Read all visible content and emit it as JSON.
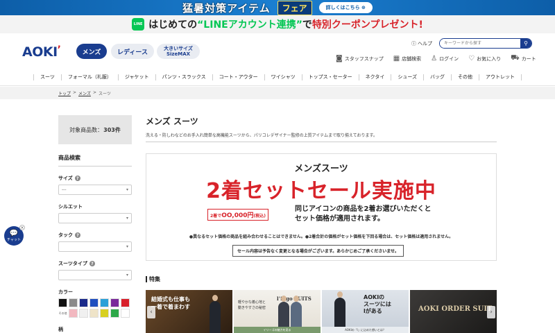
{
  "promo": {
    "title": "猛暑対策アイテム",
    "fair": "フェア",
    "button": "詳しくはこちら ⊕"
  },
  "line_banner": {
    "icon": "LINE",
    "text_pre": "はじめての",
    "text_line": "“LINEアカウント連携”",
    "text_mid": "で",
    "text_red": "特別クーポンプレゼント!"
  },
  "header": {
    "logo": "AOKI",
    "logo_accent": "’",
    "pills": {
      "mens": "メンズ",
      "ladies": "レディース",
      "big_line1": "大きいサイズ",
      "big_line2": "SizeMAX"
    },
    "help": "ヘルプ",
    "search_placeholder": "キーワードから探す",
    "util": {
      "staff": "スタッフスナップ",
      "store": "店舗検索",
      "login": "ログイン",
      "favorite": "お気に入り",
      "cart": "カート"
    }
  },
  "nav": [
    "スーツ",
    "フォーマル（礼服）",
    "ジャケット",
    "パンツ・スラックス",
    "コート・アウター",
    "ワイシャツ",
    "トップス・セーター",
    "ネクタイ",
    "シューズ",
    "バッグ",
    "その他",
    "アウトレット"
  ],
  "breadcrumb": {
    "top": "トップ",
    "mens": "メンズ",
    "current": "スーツ",
    "sep": ">"
  },
  "sidebar": {
    "count_label": "対象商品数：",
    "count_value": "303件",
    "filter_head": "商品検索",
    "size_label": "サイズ",
    "size_value": "---",
    "silhouette_label": "シルエット",
    "tuck_label": "タック",
    "suit_type_label": "スーツタイプ",
    "color_label": "カラー",
    "color_other": "その他",
    "pattern_label": "柄",
    "colors": [
      "#111111",
      "#8a8a8a",
      "#1a2a8a",
      "#1f4fbf",
      "#2aa0d8",
      "#7a2a9a",
      "#d81f2a",
      "#f2b8c0",
      "#f0f0f0",
      "#efe4c8",
      "#d8d020",
      "#2ea84a",
      "#ffffff"
    ]
  },
  "main": {
    "title": "メンズ スーツ",
    "desc": "洗える・防しわなどのお手入れ簡単な高機能スーツから、パリコレデザイナー監修の上質アイテムまで取り揃えております。",
    "sale": {
      "sub": "メンズスーツ",
      "main": "2着セットセール実施中",
      "price_tag_pre": "2着で",
      "price_tag_mid": "OO,000円",
      "price_tag_post": "(税込)",
      "explain1": "同じアイコンの商品を2着お選びいただくと",
      "explain2": "セット価格が適用されます。",
      "note": "●異なるセット価格の商品を組み合わせることはできません。●2着合計の価格がセット価格を下回る場合は、セット価格は適用されません。",
      "notice": "セール内容は予告なく変更となる場合がございます。あらかじめご了承くださいませ。"
    },
    "feature_head": "特集",
    "features": [
      {
        "text1": "結婚式も仕事も",
        "text2": "一着で着まわす"
      },
      {
        "title": "l’illgo SUITS",
        "text1": "軽やかな着心地と",
        "text2": "動きやすさの秘密",
        "foot": "イリーゴの魅力を見る"
      },
      {
        "text1": "AOKIの",
        "text2": "スーツには",
        "text3": "lがある",
        "foot": "AOKIの「l」に込めた想いとは？"
      },
      {
        "text1": "AOKI ORDER SUIT"
      }
    ]
  },
  "chat": {
    "label": "チャット",
    "close": "×"
  }
}
